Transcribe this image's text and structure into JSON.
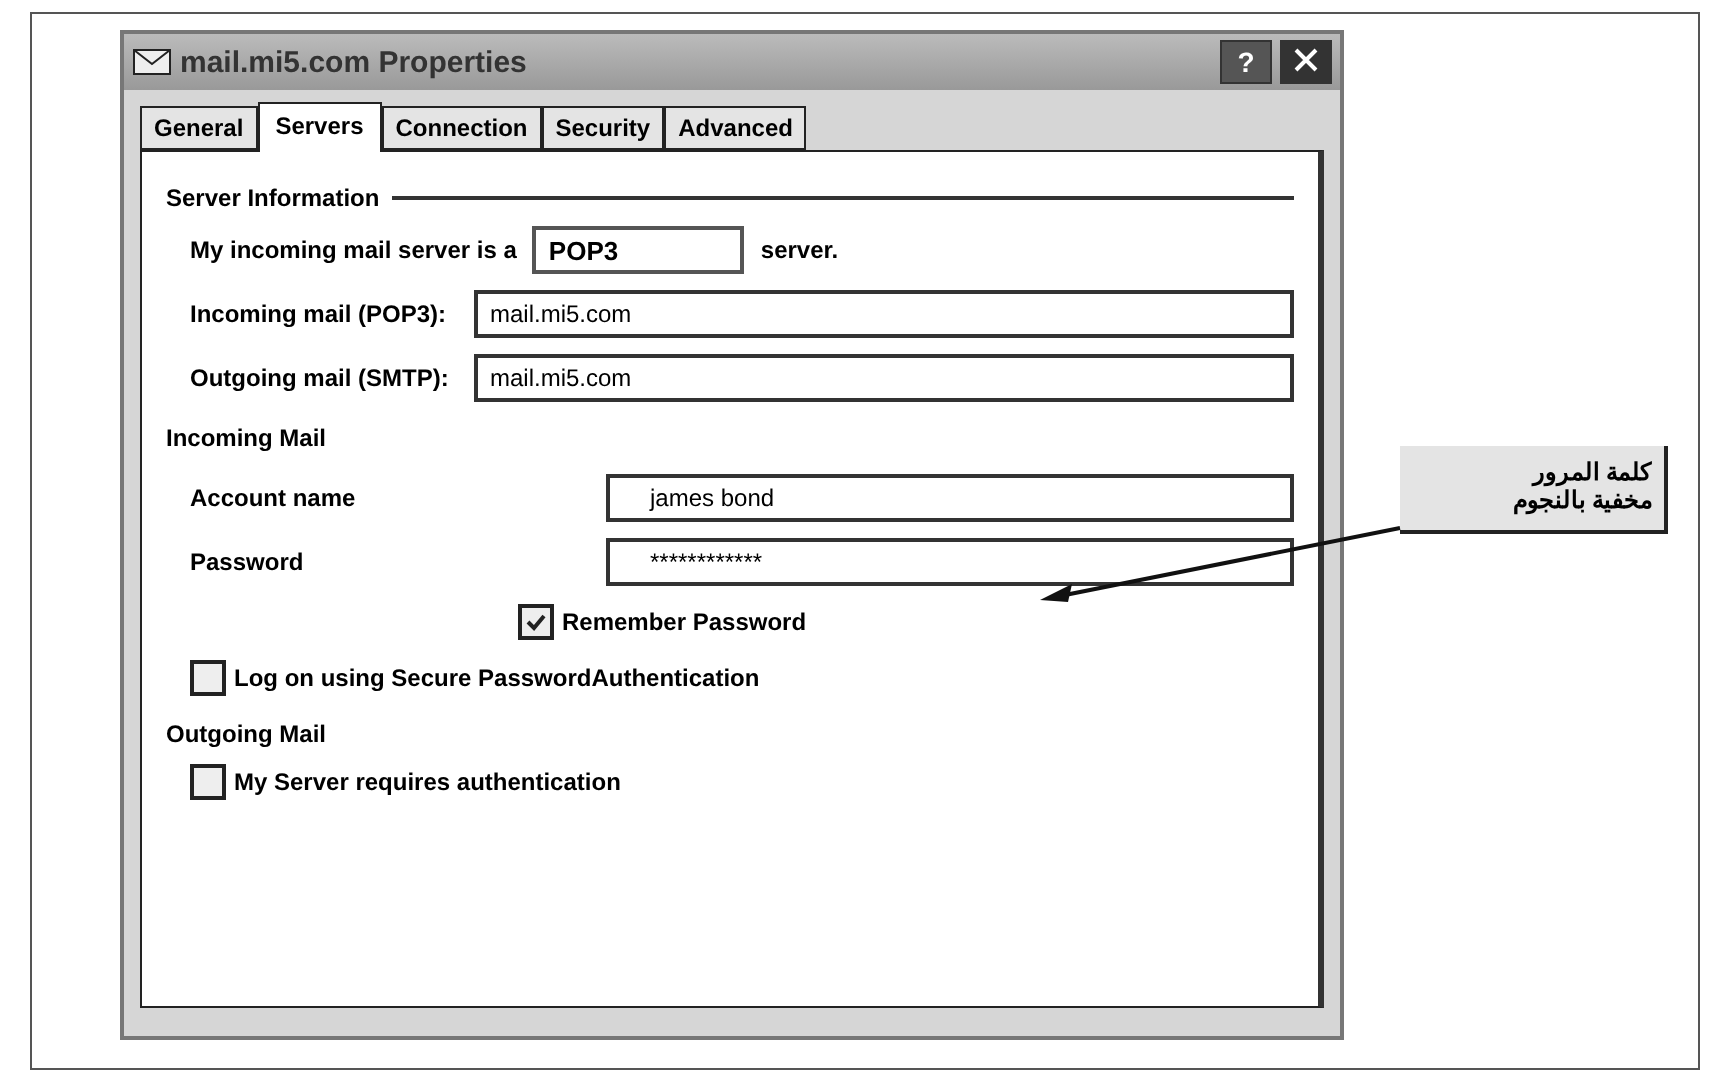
{
  "window": {
    "title": "mail.mi5.com Properties",
    "buttons": [
      {
        "kind": "help",
        "label": "?"
      },
      {
        "kind": "close"
      }
    ]
  },
  "tabs": [
    {
      "label": "General",
      "selected": false
    },
    {
      "label": "Servers",
      "selected": true
    },
    {
      "label": "Connection",
      "selected": false
    },
    {
      "label": "Security",
      "selected": false
    },
    {
      "label": "Advanced",
      "selected": false
    }
  ],
  "server_information": {
    "heading": "Server Information",
    "server_type": {
      "label": "My incoming mail server is a",
      "value": "POP3",
      "suffix": "server."
    },
    "fields": [
      {
        "label": "Incoming mail (POP3):",
        "value": "mail.mi5.com"
      },
      {
        "label": "Outgoing mail (SMTP):",
        "value": "mail.mi5.com"
      }
    ]
  },
  "incoming_mail": {
    "heading": "Incoming Mail",
    "fields": [
      {
        "label": "Account name",
        "value": "james bond"
      },
      {
        "label": "Password",
        "value": "************"
      }
    ],
    "checkboxes": [
      {
        "label": "Remember Password",
        "checked": true,
        "kind": "indented"
      },
      {
        "label": "Log on using Secure PasswordAuthentication",
        "checked": false,
        "kind": "plain"
      }
    ]
  },
  "outgoing_mail": {
    "heading": "Outgoing Mail",
    "checkboxes": [
      {
        "label": "My Server requires authentication",
        "checked": false
      }
    ]
  },
  "callout": {
    "lines": [
      "كلمة المرور",
      "مخفية بالنجوم"
    ]
  }
}
